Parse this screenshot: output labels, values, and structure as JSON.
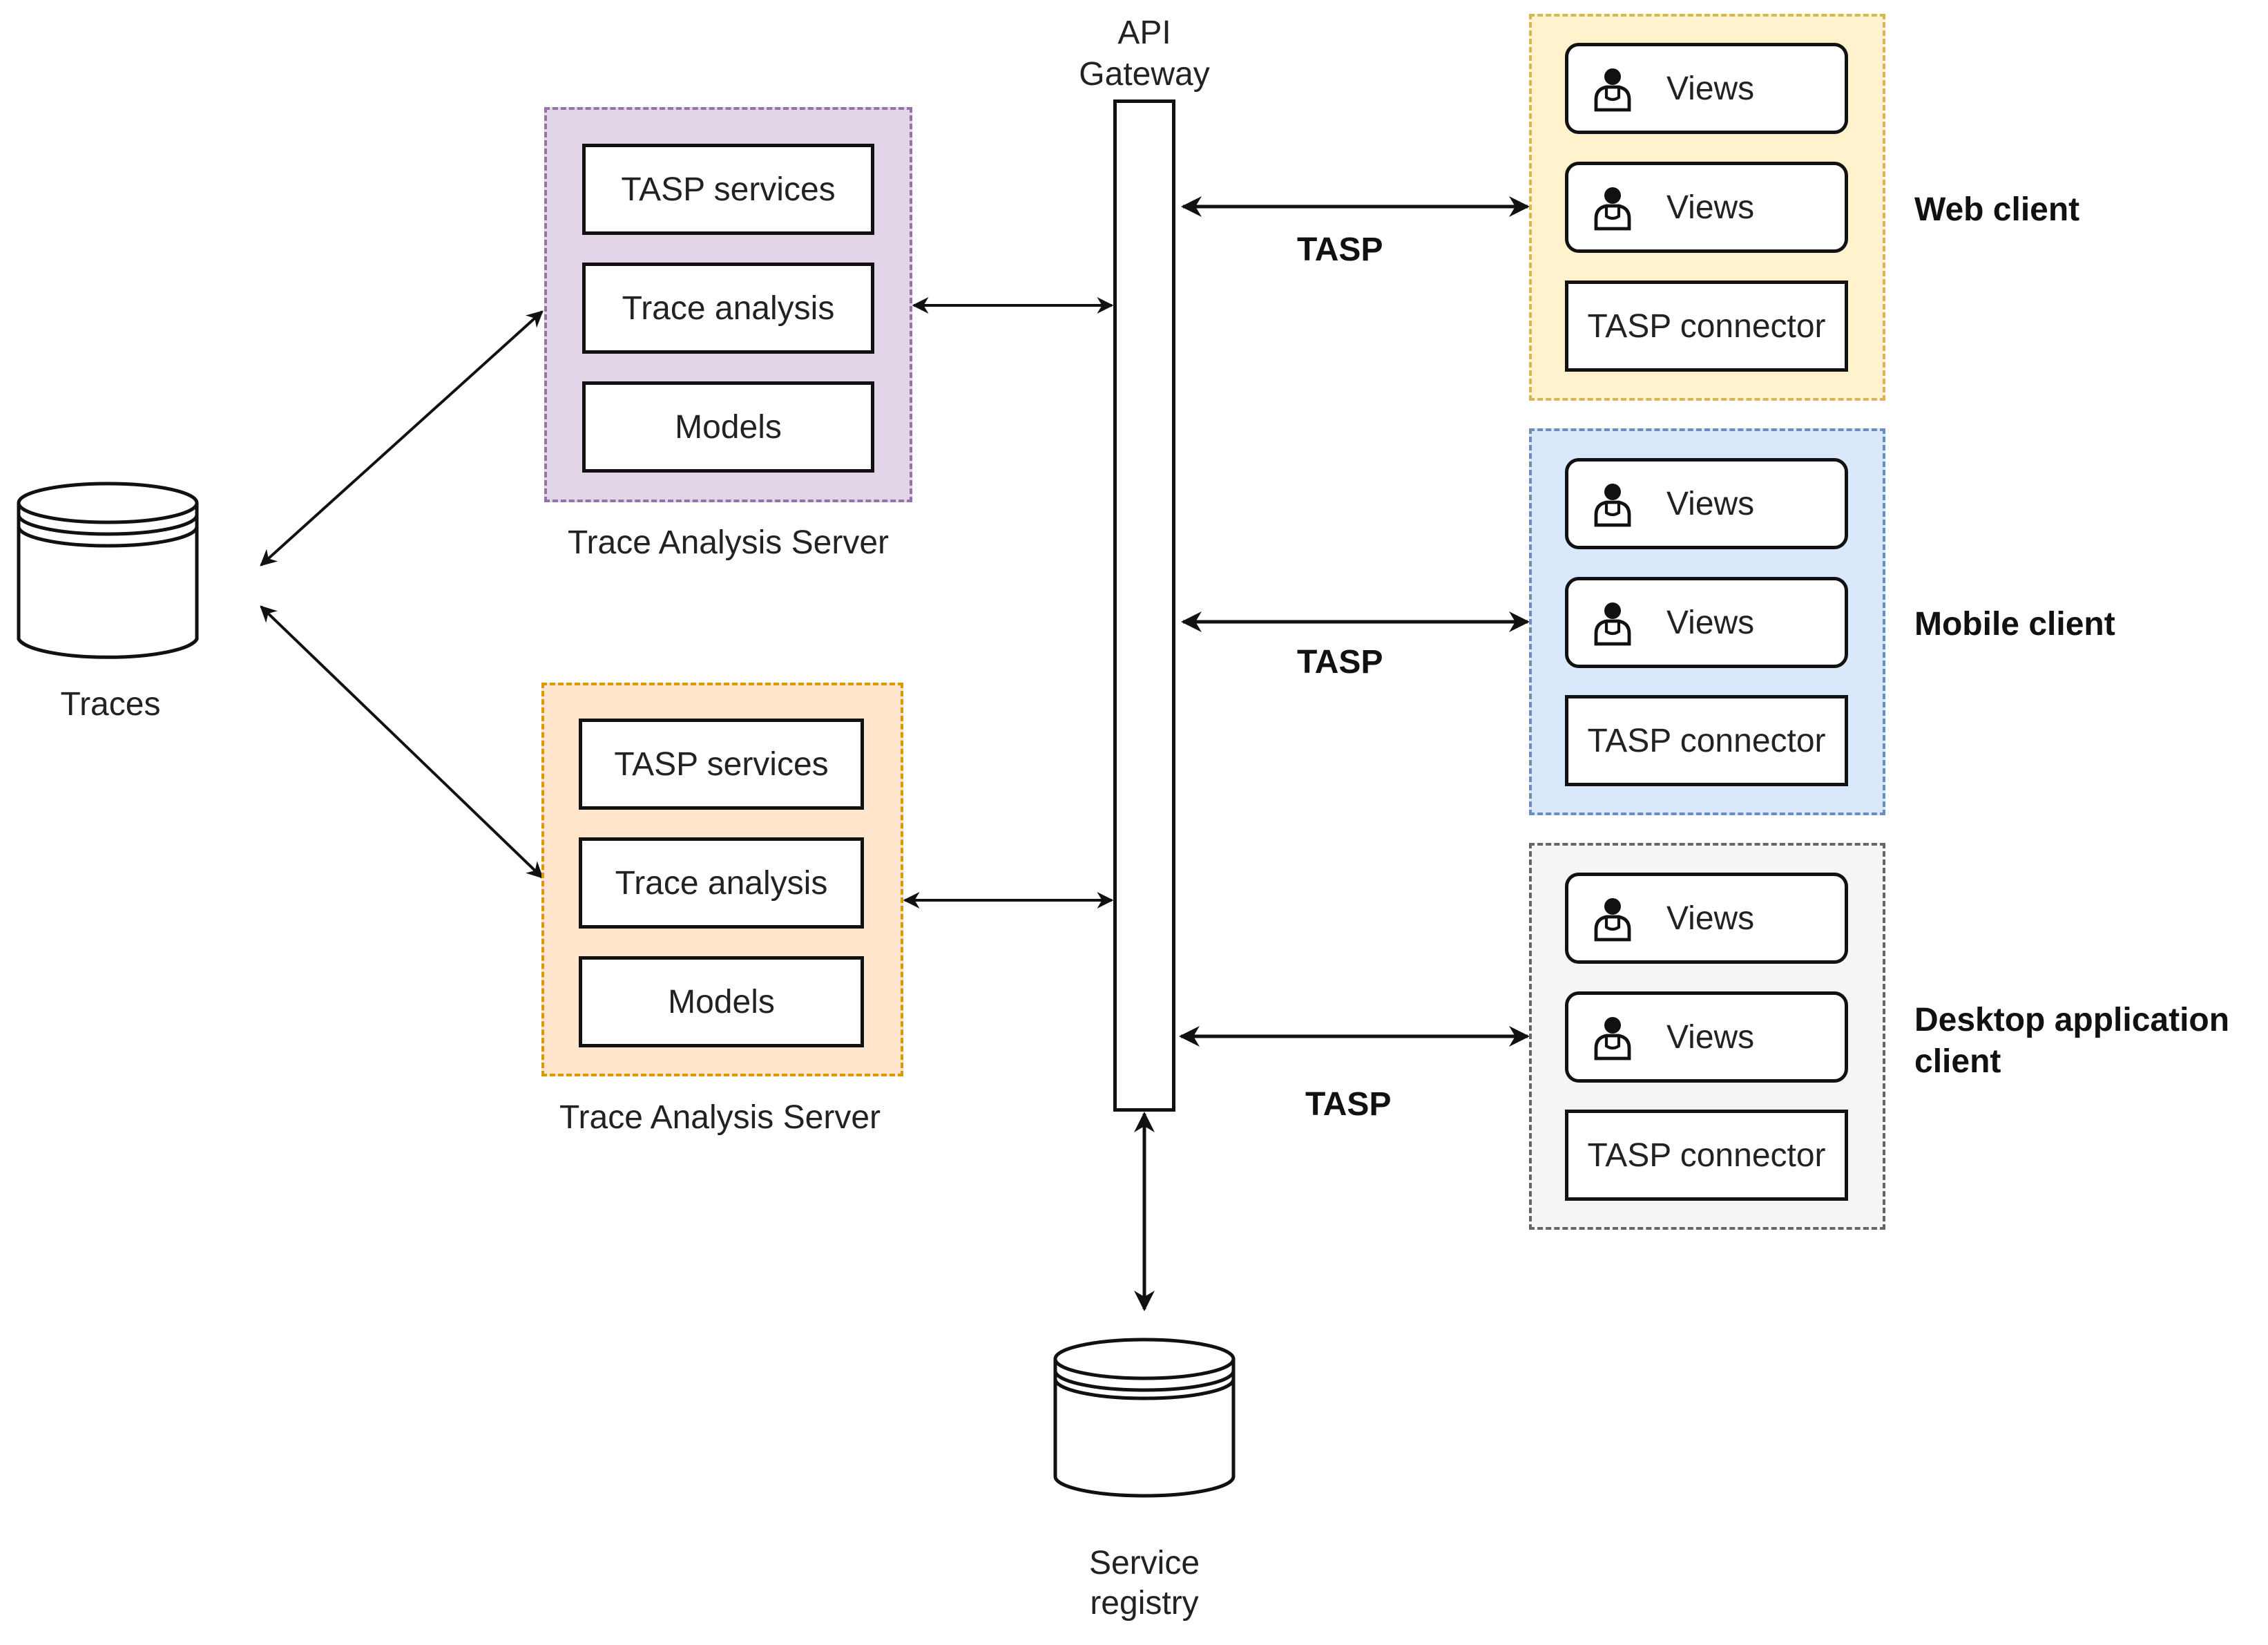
{
  "traces_db": {
    "label": "Traces"
  },
  "service_registry": {
    "label_line1": "Service",
    "label_line2": "registry"
  },
  "api_gateway": {
    "label_line1": "API",
    "label_line2": "Gateway"
  },
  "servers": [
    {
      "caption": "Trace Analysis Server",
      "fill": "#e1d5e7",
      "border": "#9673a6",
      "components": [
        "TASP services",
        "Trace analysis",
        "Models"
      ]
    },
    {
      "caption": "Trace Analysis Server",
      "fill": "#ffe6cc",
      "border": "#d79b00",
      "components": [
        "TASP services",
        "Trace analysis",
        "Models"
      ]
    }
  ],
  "clients": [
    {
      "label": "Web client",
      "fill": "#fff2cc",
      "border": "#d6b656",
      "views": [
        "Views",
        "Views"
      ],
      "connector": "TASP connector"
    },
    {
      "label": "Mobile client",
      "fill": "#dae8fc",
      "border": "#6c8ebf",
      "views": [
        "Views",
        "Views"
      ],
      "connector": "TASP connector"
    },
    {
      "label_line1": "Desktop application",
      "label_line2": "client",
      "fill": "#f5f5f5",
      "border": "#666666",
      "views": [
        "Views",
        "Views"
      ],
      "connector": "TASP connector"
    }
  ],
  "protocol_labels": [
    "TASP",
    "TASP",
    "TASP"
  ],
  "icons": {
    "view_icon": "person-icon",
    "database_icon": "database-cylinder-icon"
  }
}
